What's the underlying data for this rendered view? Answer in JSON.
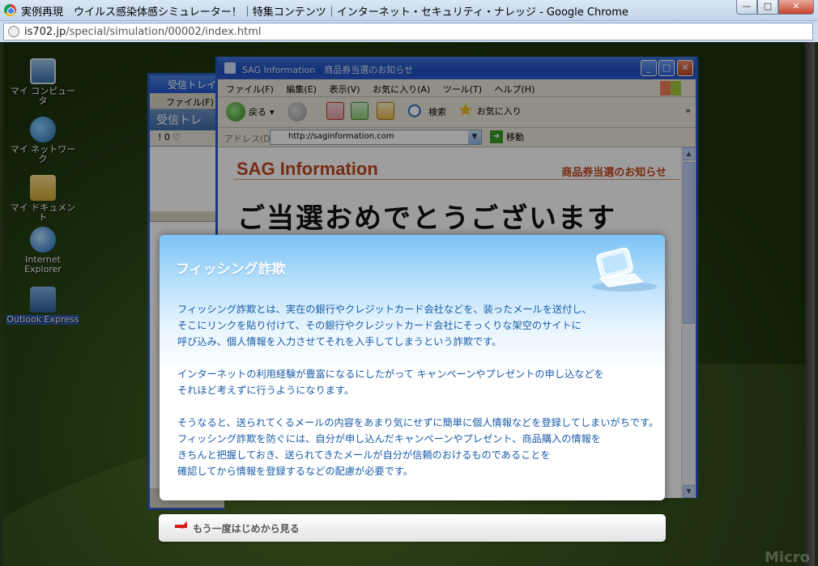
{
  "window": {
    "title": "実例再現　ウイルス感染体感シミュレーター！｜特集コンテンツ｜インターネット・セキュリティ・ナレッジ - Google Chrome",
    "url_host": "is702.jp",
    "url_path": "/special/simulation/00002/index.html",
    "min_label": "—",
    "max_label": "□",
    "close_label": "✕"
  },
  "desktop": {
    "icons": [
      {
        "label": "マイ コンピュータ",
        "icon": "computer-icon"
      },
      {
        "label": "マイ ネットワーク",
        "icon": "network-icon"
      },
      {
        "label": "マイ ドキュメント",
        "icon": "documents-icon"
      },
      {
        "label": "Internet Explorer",
        "icon": "ie-icon"
      },
      {
        "label": "Outlook Express",
        "icon": "outlook-icon"
      }
    ],
    "watermark": "Micro"
  },
  "outlook_window": {
    "title": "受信トレイ",
    "menu_file": "ファイル(F)",
    "header": "受信トレ",
    "cols": "!  0  ♡"
  },
  "ie_window": {
    "title": "SAG Information　商品券当選のお知らせ",
    "menu": [
      "ファイル(F)",
      "編集(E)",
      "表示(V)",
      "お気に入り(A)",
      "ツール(T)",
      "ヘルプ(H)"
    ],
    "toolbar": {
      "back": "戻る",
      "search": "検索",
      "favorites": "お気に入り"
    },
    "address_label": "アドレス(D)",
    "address_value": "http://saginformation.com",
    "go_label": "移動",
    "page": {
      "logo": "SAG Information",
      "sub": "商品券当選のお知らせ",
      "headline": "ご当選おめでとうございます"
    }
  },
  "modal": {
    "title": "フィッシング詐欺",
    "paragraphs": [
      "フィッシング詐欺とは、実在の銀行やクレジットカード会社などを、装ったメールを送付し、\nそこにリンクを貼り付けて、その銀行やクレジットカード会社にそっくりな架空のサイトに\n呼び込み、個人情報を入力させてそれを入手してしまうという詐欺です。",
      "インターネットの利用経験が豊富になるにしたがって キャンペーンやプレゼントの申し込などを\nそれほど考えずに行うようになります。",
      "そうなると、送られてくるメールの内容をあまり気にせずに簡単に個人情報などを登録してしまいがちです。\nフィッシング詐欺を防ぐには、自分が申し込んだキャンペーンやプレゼント、商品購入の情報を\nきちんと把握しておき、送られてきたメールが自分が信頼のおけるものであることを\n確認してから情報を登録するなどの配慮が必要です。"
    ]
  },
  "restart": {
    "label": "もう一度はじめから見る"
  },
  "colors": {
    "modal_text": "#1a5ca8",
    "sag_accent": "#c1461d",
    "xp_blue": "#2e59c0"
  }
}
